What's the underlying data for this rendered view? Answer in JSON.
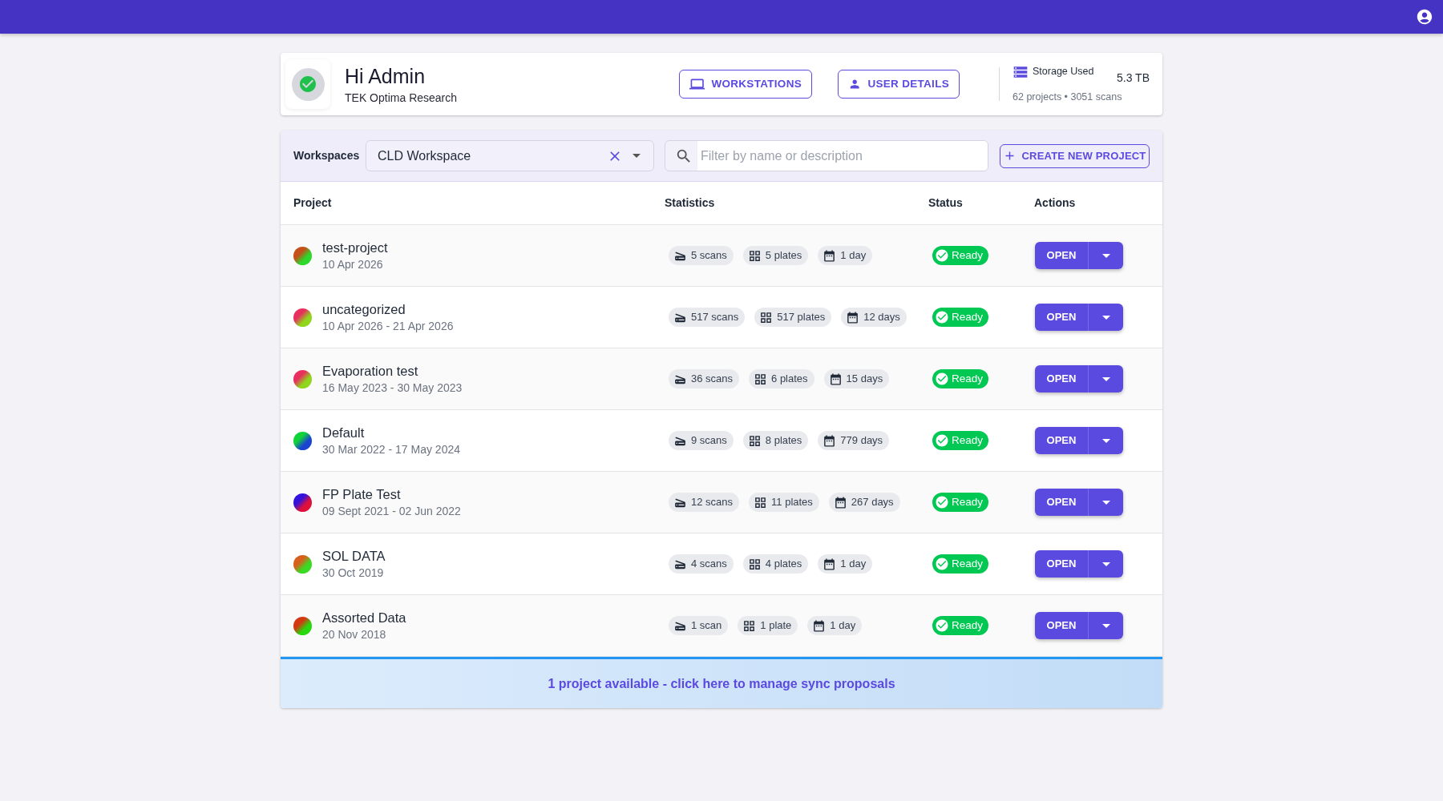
{
  "header": {
    "greeting": "Hi Admin",
    "organization": "TEK Optima Research",
    "buttons": [
      {
        "label": "WORKSTATIONS",
        "kind": "workstations"
      },
      {
        "label": "USER DETAILS",
        "kind": "user"
      }
    ],
    "storage": {
      "label": "Storage Used",
      "value": "5.3 TB",
      "summary": "62 projects • 3051 scans"
    }
  },
  "toolbar": {
    "workspace_label": "Workspaces",
    "workspace_select": {
      "value": "CLD Workspace"
    },
    "search": {
      "placeholder": "Filter by name or description"
    },
    "create_button": "CREATE NEW PROJECT"
  },
  "table": {
    "columns": [
      "Project",
      "Statistics",
      "Status",
      "Actions"
    ],
    "rows": [
      {
        "name": "test-project",
        "dates": "10 Apr 2026",
        "gradient": [
          {
            "color": "#c4501a"
          },
          {
            "color": "#2bd82b"
          }
        ],
        "stats": [
          {
            "kind": "scans",
            "text": "5 scans"
          },
          {
            "kind": "plates",
            "text": "5 plates"
          },
          {
            "kind": "days",
            "text": "1 day"
          }
        ],
        "status": "Ready",
        "action": "OPEN"
      },
      {
        "name": "uncategorized",
        "dates": "10 Apr 2026 - 21 Apr 2026",
        "gradient": [
          {
            "color": "#e8305e"
          },
          {
            "color": "#8fd61c"
          }
        ],
        "stats": [
          {
            "kind": "scans",
            "text": "517 scans"
          },
          {
            "kind": "plates",
            "text": "517 plates"
          },
          {
            "kind": "days",
            "text": "12 days"
          }
        ],
        "status": "Ready",
        "action": "OPEN"
      },
      {
        "name": "Evaporation test",
        "dates": "16 May 2023 - 30 May 2023",
        "gradient": [
          {
            "color": "#e8305e"
          },
          {
            "color": "#8fd61c"
          }
        ],
        "stats": [
          {
            "kind": "scans",
            "text": "36 scans"
          },
          {
            "kind": "plates",
            "text": "6 plates"
          },
          {
            "kind": "days",
            "text": "15 days"
          }
        ],
        "status": "Ready",
        "action": "OPEN"
      },
      {
        "name": "Default",
        "dates": "30 Mar 2022 - 17 May 2024",
        "gradient": [
          {
            "color": "#10d33a"
          },
          {
            "color": "#1a44d0"
          }
        ],
        "stats": [
          {
            "kind": "scans",
            "text": "9 scans"
          },
          {
            "kind": "plates",
            "text": "8 plates"
          },
          {
            "kind": "days",
            "text": "779 days"
          }
        ],
        "status": "Ready",
        "action": "OPEN"
      },
      {
        "name": "FP Plate Test",
        "dates": "09 Sept 2021 - 02 Jun 2022",
        "gradient": [
          {
            "color": "#3312dc"
          },
          {
            "color": "#e0103a"
          }
        ],
        "stats": [
          {
            "kind": "scans",
            "text": "12 scans"
          },
          {
            "kind": "plates",
            "text": "11 plates"
          },
          {
            "kind": "days",
            "text": "267 days"
          }
        ],
        "status": "Ready",
        "action": "OPEN"
      },
      {
        "name": "SOL DATA",
        "dates": "30 Oct 2019",
        "gradient": [
          {
            "color": "#d8601e"
          },
          {
            "color": "#3bda24"
          }
        ],
        "stats": [
          {
            "kind": "scans",
            "text": "4 scans"
          },
          {
            "kind": "plates",
            "text": "4 plates"
          },
          {
            "kind": "days",
            "text": "1 day"
          }
        ],
        "status": "Ready",
        "action": "OPEN"
      },
      {
        "name": "Assorted Data",
        "dates": "20 Nov 2018",
        "gradient": [
          {
            "color": "#d43812"
          },
          {
            "color": "#28d80e"
          }
        ],
        "stats": [
          {
            "kind": "scans",
            "text": "1 scan"
          },
          {
            "kind": "plates",
            "text": "1 plate"
          },
          {
            "kind": "days",
            "text": "1 day"
          }
        ],
        "status": "Ready",
        "action": "OPEN"
      }
    ]
  },
  "footer": {
    "text": "1 project available - click here to manage sync proposals"
  }
}
